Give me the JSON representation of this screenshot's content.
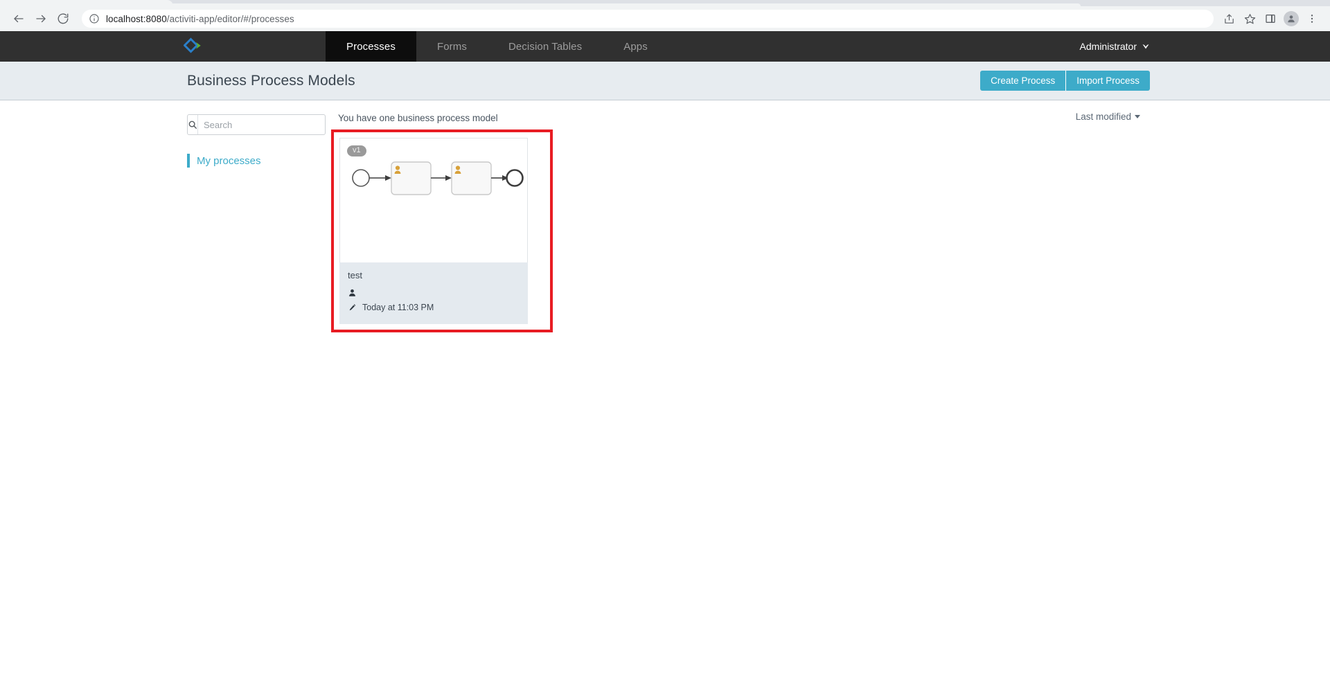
{
  "browser": {
    "back_label": "Back",
    "forward_label": "Forward",
    "reload_label": "Reload",
    "url_prefix": "localhost:8080",
    "url_path": "/activiti-app/editor/#/processes",
    "url_full": "localhost:8080/activiti-app/editor/#/processes",
    "icons": {
      "site_info": "info-icon",
      "share": "share-icon",
      "bookmark": "star-icon",
      "side_panel": "side-panel-icon",
      "profile": "profile-avatar-icon",
      "menu": "three-dot-menu-icon"
    }
  },
  "app_nav": {
    "logo_name": "activiti-logo",
    "logo_colors": {
      "blue": "#2a7fc9",
      "green": "#5eb130"
    },
    "tabs": [
      {
        "label": "Processes",
        "active": true
      },
      {
        "label": "Forms",
        "active": false
      },
      {
        "label": "Decision Tables",
        "active": false
      },
      {
        "label": "Apps",
        "active": false
      }
    ],
    "user": {
      "name": "Administrator"
    },
    "bar_color": "#303030",
    "active_tab_color": "#0d0d0d"
  },
  "page_header": {
    "title": "Business Process Models",
    "buttons": [
      {
        "label": "Create Process"
      },
      {
        "label": "Import Process"
      }
    ],
    "button_color": "#3dabc9",
    "band_color": "#e7ecf0"
  },
  "sidebar": {
    "search": {
      "placeholder": "Search",
      "value": "",
      "icon": "search-icon"
    },
    "filters": [
      {
        "label": "My processes",
        "active": true
      }
    ],
    "accent_color": "#3dabc9"
  },
  "listing": {
    "count_text": "You have one business process model",
    "sort": {
      "label": "Last modified",
      "icon": "chevron-down-icon"
    },
    "highlight_color": "#e81c23",
    "cards": [
      {
        "version_badge": "v1",
        "name": "test",
        "author": "",
        "modified": "Today at 11:03 PM",
        "author_icon": "person-icon",
        "modified_icon": "pencil-icon",
        "diagram": {
          "type": "bpmn",
          "nodes": [
            {
              "kind": "start-event",
              "label": ""
            },
            {
              "kind": "user-task",
              "label": ""
            },
            {
              "kind": "user-task",
              "label": ""
            },
            {
              "kind": "end-event",
              "label": ""
            }
          ],
          "task_icon": "user-task-person-icon",
          "task_icon_color": "#d8a13a"
        }
      }
    ]
  }
}
